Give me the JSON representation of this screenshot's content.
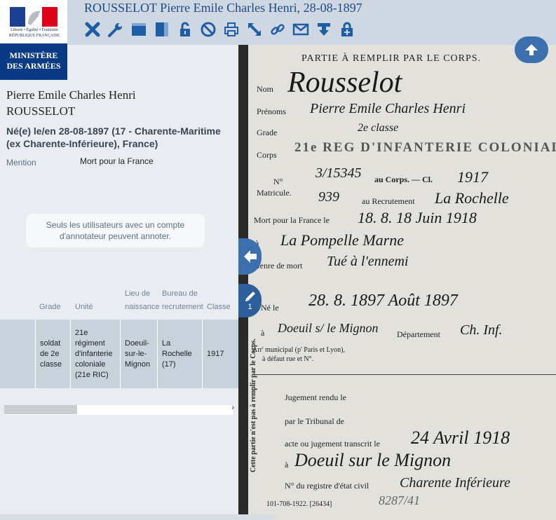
{
  "logo": {
    "marianne_line1": "Liberté • Égalité • Fraternité",
    "marianne_line2": "RÉPUBLIQUE FRANÇAISE",
    "ministere_line1": "MINISTÈRE",
    "ministere_line2": "DES ARMÉES"
  },
  "header": {
    "title": "ROUSSELOT Pierre Emile Charles Henri, 28-08-1897",
    "toolbar": [
      "close-icon",
      "wrench-icon",
      "horizontal-layout-icon",
      "vertical-layout-icon",
      "unlock-icon",
      "block-icon",
      "print-icon",
      "expand-icon",
      "link-icon",
      "email-icon",
      "download-icon",
      "lock-plus-icon"
    ]
  },
  "person": {
    "name_line1": "Pierre Emile Charles Henri",
    "name_line2": "ROUSSELOT",
    "birth": "Né(e) le/en 28-08-1897 (17 - Charente-Maritime (ex Charente-Inférieure), France)",
    "mention_label": "Mention",
    "mention_value": "Mort pour la France"
  },
  "notice": "Seuls les utilisateurs avec un compte d'annotateur peuvent annoter.",
  "table": {
    "headers": {
      "grade": "Grade",
      "unite": "Unité",
      "lieu": "Lieu de naissance",
      "bureau": "Bureau de recrutement",
      "classe": "Classe"
    },
    "row": {
      "grade": "soldat de 2e classe",
      "unite": "21e régiment d'infanterie coloniale (21e RIC)",
      "lieu": "Doeuil-sur-le-Mignon",
      "bureau": "La Rochelle (17)",
      "classe": "1917"
    }
  },
  "viewer": {
    "edit_count": "1",
    "doc": {
      "header": "PARTIE À REMPLIR PAR LE CORPS.",
      "nom_label": "Nom",
      "nom_value": "Rousselot",
      "prenoms_label": "Prénoms",
      "prenoms_value": "Pierre Emile Charles Henri",
      "grade_label": "Grade",
      "grade_value": "2e classe",
      "corps_label": "Corps",
      "corps_value": "21e REG D'INFANTERIE COLONIALE",
      "no_label": "N°",
      "matricule_label": "Matricule.",
      "no_corps_value": "3/15345",
      "au_corps": "au Corps. — Cl.",
      "classe_value": "1917",
      "matricule_value": "939",
      "au_recrutement": "au Recrutement",
      "recrutement_value": "La Rochelle",
      "mort_label": "Mort pour la France le",
      "mort_value": "18. 8. 18 Juin 1918",
      "a_label": "à",
      "lieu_mort_value": "La Pompelle Marne",
      "genre_label": "Genre de mort",
      "genre_value": "Tué à l'ennemi",
      "ne_label": "Né le",
      "ne_value": "28. 8. 1897 Août 1897",
      "ne_a_label": "à",
      "ne_lieu_value": "Doeuil s/ le Mignon",
      "departement_label": "Département",
      "departement_value": "Ch. Inf.",
      "arr_label": "Arr' municipal (p' Paris et Lyon),",
      "arr_label2": "à défaut rue et N°.",
      "jugement_label": "Jugement rendu le",
      "tribunal_label": "par le Tribunal de",
      "transcrit_label": "acte ou jugement transcrit le",
      "transcrit_value": "24 Avril 1918",
      "transcrit_a_label": "à",
      "transcrit_lieu_value": "Doeuil sur le Mignon",
      "registre_label": "N° du registre d'état civil",
      "registre_value": "Charente Inférieure",
      "side_note": "Cette partie n'est pas à remplir par le Corps.",
      "footer": "101-708-1922. [26434]",
      "footer_hand": "8287/41"
    }
  }
}
